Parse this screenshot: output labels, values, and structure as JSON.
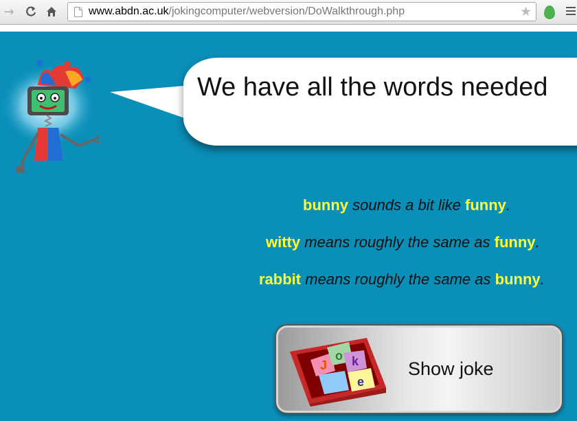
{
  "browser": {
    "url_host": "www.abdn.ac.uk",
    "url_path": "/jokingcomputer/webversion/DoWalkthrough.php"
  },
  "icons": {
    "back": "arrow-right-icon",
    "reload": "reload-icon",
    "home": "home-icon",
    "bookmark": "star-icon",
    "extension": "leaf-icon",
    "menu": "hamburger-menu-icon"
  },
  "colors": {
    "page_background": "#0a8fb9",
    "highlight_word": "#ffff33"
  },
  "speech_bubble": {
    "text": "We have all the words needed"
  },
  "facts": [
    {
      "word_a": "bunny",
      "relation": "sounds a bit like",
      "word_b": "funny",
      "end": "."
    },
    {
      "word_a": "witty",
      "relation": "means roughly the same as",
      "word_b": "funny",
      "end": "."
    },
    {
      "word_a": "rabbit",
      "relation": "means roughly the same as",
      "word_b": "bunny",
      "end": "."
    }
  ],
  "joke_button": {
    "label": "Show joke",
    "box_letters": [
      "J",
      "o",
      "k",
      "e"
    ]
  }
}
